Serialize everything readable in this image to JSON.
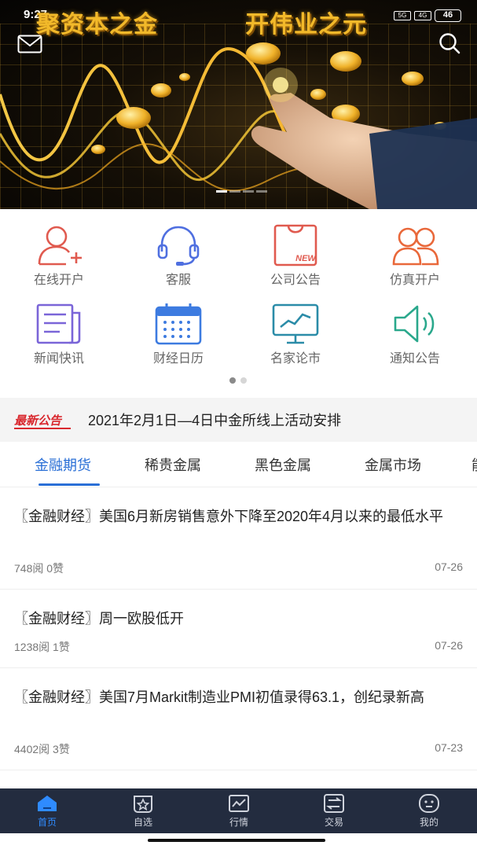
{
  "status_bar": {
    "time": "9:27",
    "network": "5G",
    "network2": "4G",
    "battery": "46"
  },
  "banner": {
    "left_text": "聚资本之金",
    "right_text": "开伟业之元"
  },
  "menu": {
    "items": [
      {
        "label": "在线开户",
        "icon": "add-user-icon"
      },
      {
        "label": "客服",
        "icon": "headset-icon"
      },
      {
        "label": "公司公告",
        "icon": "new-bag-icon",
        "icon_text": "NEW"
      },
      {
        "label": "仿真开户",
        "icon": "users-icon"
      },
      {
        "label": "新闻快讯",
        "icon": "newspaper-icon"
      },
      {
        "label": "财经日历",
        "icon": "calendar-icon"
      },
      {
        "label": "名家论市",
        "icon": "monitor-chart-icon"
      },
      {
        "label": "通知公告",
        "icon": "speaker-icon"
      }
    ]
  },
  "notice": {
    "badge": "最新公告",
    "text": "2021年2月1日—4日中金所线上活动安排"
  },
  "tabs": [
    "金融期货",
    "稀贵金属",
    "黑色金属",
    "金属市场",
    "能"
  ],
  "news": [
    {
      "title": "〖金融财经〗美国6月新房销售意外下降至2020年4月以来的最低水平",
      "stats": "748阅  0赞",
      "date": "07-26"
    },
    {
      "title": "〖金融财经〗周一欧股低开",
      "stats": "1238阅  1赞",
      "date": "07-26"
    },
    {
      "title": "〖金融财经〗美国7月Markit制造业PMI初值录得63.1，创纪录新高",
      "stats": "4402阅  3赞",
      "date": "07-23"
    }
  ],
  "bottom_nav": [
    {
      "label": "首页",
      "icon": "home-icon"
    },
    {
      "label": "自选",
      "icon": "star-icon"
    },
    {
      "label": "行情",
      "icon": "chart-icon"
    },
    {
      "label": "交易",
      "icon": "exchange-icon"
    },
    {
      "label": "我的",
      "icon": "profile-icon"
    }
  ],
  "colors": {
    "accent": "#2a6fd6",
    "nav_bg": "#232c3f",
    "notice_red": "#d9282e",
    "icon_red": "#e05a4f",
    "icon_blue": "#3d7be0"
  }
}
